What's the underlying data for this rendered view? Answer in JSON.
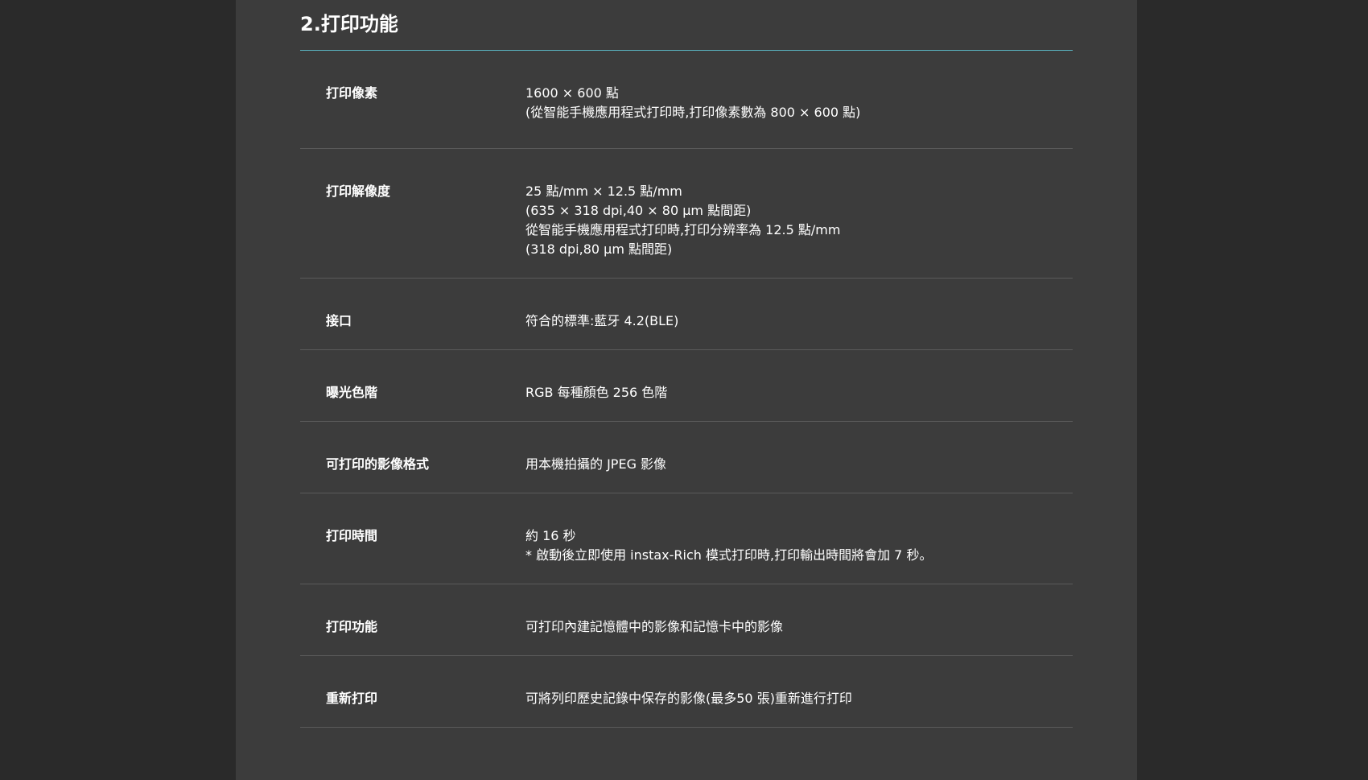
{
  "section": {
    "title": "2.打印功能"
  },
  "specs": [
    {
      "label": "打印像素",
      "lines": [
        "1600 × 600 點",
        "(從智能手機應用程式打印時,打印像素數為 800 × 600 點)"
      ]
    },
    {
      "label": "打印解像度",
      "lines": [
        "25 點/mm × 12.5 點/mm",
        "(635 × 318 dpi,40 × 80 µm 點間距)",
        "從智能手機應用程式打印時,打印分辨率為 12.5 點/mm",
        "(318 dpi,80 µm 點間距)"
      ]
    },
    {
      "label": "接口",
      "lines": [
        "符合的標準:藍牙 4.2(BLE)"
      ]
    },
    {
      "label": "曝光色階",
      "lines": [
        "RGB 每種顏色 256 色階"
      ]
    },
    {
      "label": "可打印的影像格式",
      "lines": [
        "用本機拍攝的 JPEG 影像"
      ]
    },
    {
      "label": "打印時間",
      "lines": [
        "約 16 秒",
        "* 啟動後立即使用 instax-Rich 模式打印時,打印輸出時間將會加 7 秒。"
      ]
    },
    {
      "label": "打印功能",
      "lines": [
        "可打印內建記憶體中的影像和記憶卡中的影像"
      ]
    },
    {
      "label": "重新打印",
      "lines": [
        "可將列印歷史記錄中保存的影像(最多50 張)重新進行打印"
      ]
    }
  ]
}
